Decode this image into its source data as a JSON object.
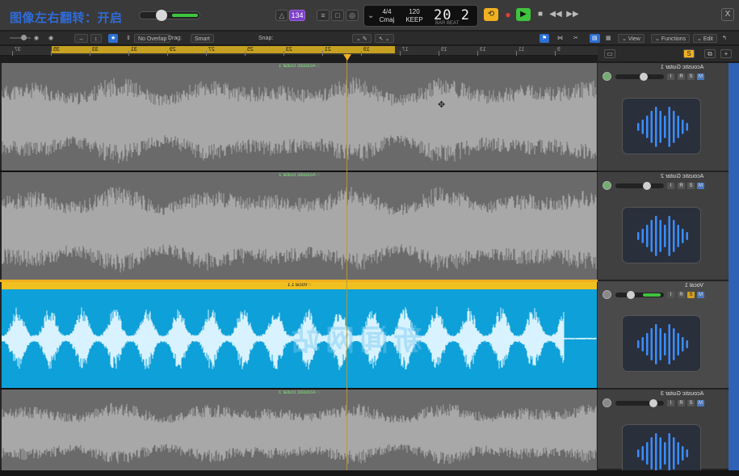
{
  "overlay": {
    "title": "图像左右翻转：开启"
  },
  "control_bar": {
    "badge_value": "134",
    "lcd": {
      "signature": "4/4",
      "key": "Cmaj",
      "tempo": "120",
      "tempo_label": "KEEP",
      "position": "20 2",
      "position_label": "BAR  BEAT"
    },
    "close_label": "X"
  },
  "toolbar": {
    "edit": "Edit",
    "functions": "Functions",
    "view": "View",
    "snap_label": "Snap:",
    "snap_value": "Smart",
    "drag_label": "Drag:",
    "drag_value": "No Overlap"
  },
  "ruler": {
    "marks": [
      "37",
      "35",
      "33",
      "31",
      "29",
      "27",
      "25",
      "23",
      "21",
      "19",
      "17",
      "15",
      "13",
      "11",
      "9"
    ]
  },
  "tracks": [
    {
      "name": "Acoustic Guitar 1",
      "region_label": "Acoustic Guitar 1",
      "number": "1",
      "color": "#6a6a6a",
      "selected": false
    },
    {
      "name": "Acoustic Guitar 2",
      "region_label": "Acoustic Guitar 2",
      "number": "2",
      "color": "#6a6a6a",
      "selected": false
    },
    {
      "name": "Vocal 1",
      "region_label": "Vocal 1.1",
      "number": "3",
      "color": "#0ea0d8",
      "selected": true
    },
    {
      "name": "Acoustic Guitar 3",
      "region_label": "Acoustic Guitar 3",
      "number": "4",
      "color": "#6a6a6a",
      "selected": false
    }
  ],
  "track_buttons": {
    "mute": "M",
    "solo": "S",
    "record": "R",
    "input": "I"
  },
  "watermark": "新闻网站",
  "colors": {
    "accent": "#f0b020",
    "play": "#3ec43e",
    "selected_region": "#0ea0d8",
    "waveform": "#a8a8a8"
  }
}
